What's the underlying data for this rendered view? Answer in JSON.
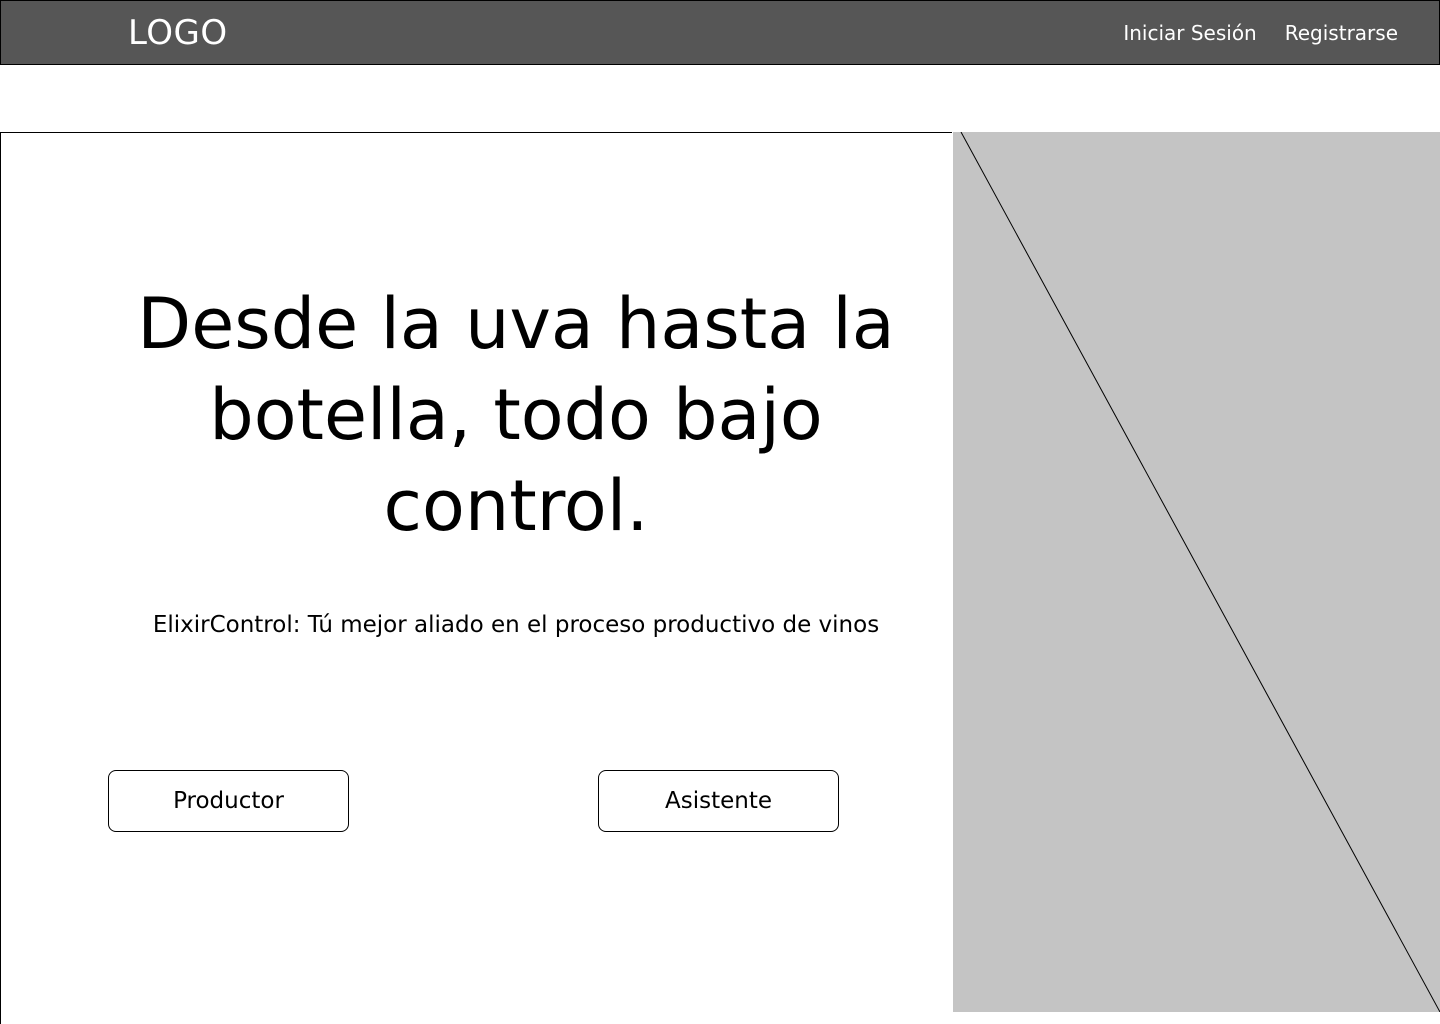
{
  "header": {
    "logo": "LOGO",
    "nav": {
      "login": "Iniciar Sesión",
      "register": "Registrarse"
    }
  },
  "hero": {
    "headline": "Desde la uva hasta la botella, todo bajo control.",
    "tagline": "ElixirControl: Tú mejor aliado en el proceso productivo de vinos",
    "buttons": {
      "producer": "Productor",
      "assistant": "Asistente"
    }
  },
  "colors": {
    "navbar_bg": "#565656",
    "placeholder_bg": "#c4c4c4",
    "text": "#000000",
    "nav_text": "#ffffff"
  }
}
